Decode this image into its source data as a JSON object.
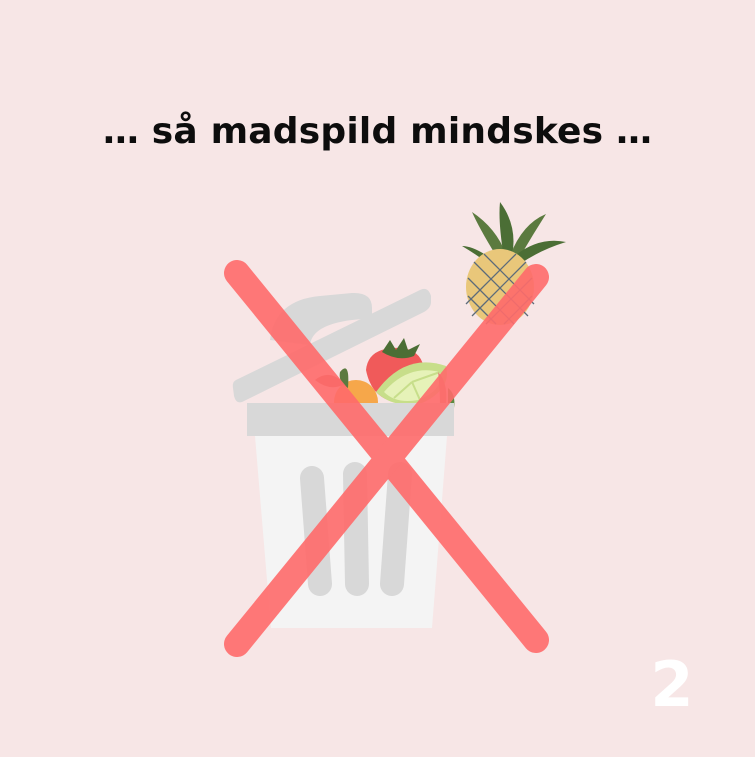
{
  "headline": "… så madspild mindskes …",
  "page_number": "2",
  "colors": {
    "background": "#f7e6e6",
    "headline": "#0d0d0d",
    "cross": "#ff6b6b",
    "bin_body": "#f4f4f4",
    "bin_lid": "#d8d8d8",
    "page_number": "#ffffff"
  },
  "icons": [
    "trash-bin-icon",
    "pineapple-icon",
    "strawberry-icon",
    "lime-slice-icon",
    "orange-icon",
    "cross-out-icon"
  ]
}
